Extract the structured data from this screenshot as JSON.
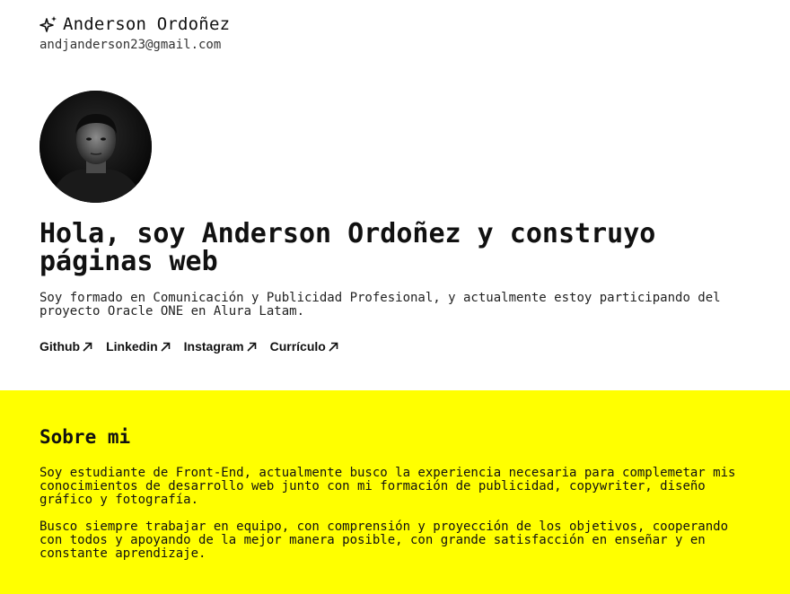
{
  "header": {
    "name": "Anderson Ordoñez",
    "email": "andjanderson23@gmail.com",
    "icon": "sparkle-icon"
  },
  "hero": {
    "title": "Hola, soy Anderson Ordoñez y construyo páginas web",
    "description": "Soy formado en Comunicación y Publicidad Profesional, y actualmente estoy participando del proyecto Oracle ONE en Alura Latam."
  },
  "links": [
    {
      "label": "Github",
      "icon": "arrow-up-right-icon"
    },
    {
      "label": "Linkedin",
      "icon": "arrow-up-right-icon"
    },
    {
      "label": "Instagram",
      "icon": "arrow-up-right-icon"
    },
    {
      "label": "Currículo",
      "icon": "arrow-up-right-icon"
    }
  ],
  "about": {
    "title": "Sobre mi",
    "paragraph1": "Soy estudiante de Front-End, actualmente busco la experiencia necesaria para complemetar mis conocimientos de desarrollo web junto con mi formación de publicidad, copywriter, diseño gráfico y fotografía.",
    "paragraph2": "Busco siempre trabajar en equipo, con comprensión y proyección de los objetivos, cooperando con todos y apoyando de la mejor manera posible, con grande satisfacción en enseñar y en constante aprendizaje."
  },
  "colors": {
    "accent": "#ffff00",
    "text": "#111111",
    "background": "#ffffff"
  }
}
